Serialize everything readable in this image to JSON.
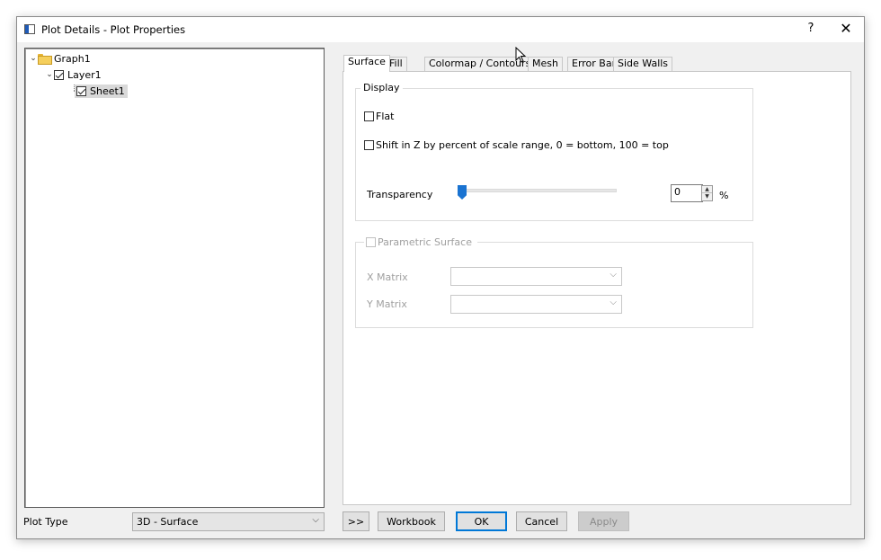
{
  "window": {
    "title": "Plot Details - Plot Properties",
    "help_glyph": "?",
    "close_glyph": "✕"
  },
  "tree": {
    "graph": "Graph1",
    "layer": "Layer1",
    "sheet": "Sheet1",
    "chevron": "⌄"
  },
  "tabs": [
    "Surface",
    "Fill",
    "Colormap / Contours",
    "Mesh",
    "Error Bar",
    "Side Walls"
  ],
  "display_group": {
    "title": "Display",
    "flat_label": "Flat",
    "shift_label": "Shift in Z by percent of scale range, 0 = bottom, 100 = top",
    "transparency_label": "Transparency",
    "transparency_value": "0",
    "transparency_percent": 0,
    "unit": "%"
  },
  "parametric_group": {
    "title": "Parametric Surface",
    "x_matrix_label": "X Matrix",
    "y_matrix_label": "Y Matrix",
    "x_matrix_value": "",
    "y_matrix_value": "",
    "dropdown_glyph": "⌵"
  },
  "bottom": {
    "plot_type_label": "Plot Type",
    "plot_type_value": "3D - Surface",
    "expand_label": ">>",
    "workbook_label": "Workbook",
    "ok_label": "OK",
    "cancel_label": "Cancel",
    "apply_label": "Apply"
  }
}
